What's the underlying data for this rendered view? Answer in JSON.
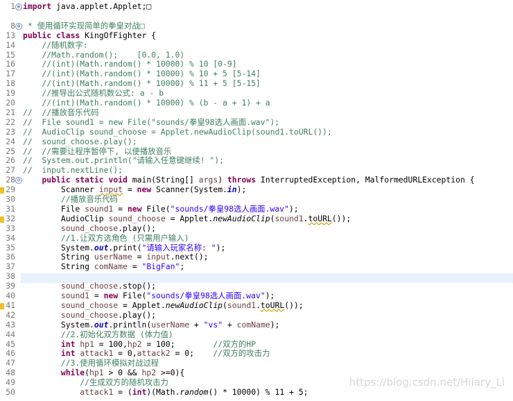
{
  "editor": {
    "language": "Java",
    "folded_line_markers": [
      "⊕",
      "⊕",
      "⊖"
    ],
    "lines": [
      {
        "n": "1",
        "segs": [
          {
            "c": "kw",
            "t": "import"
          },
          {
            "c": "",
            "t": " java.applet.Applet;□"
          }
        ]
      },
      {
        "n": "",
        "segs": []
      },
      {
        "n": "8",
        "segs": [
          {
            "c": "cm",
            "t": " * 使用循环实现简单的拳皇对战□"
          }
        ]
      },
      {
        "n": "13",
        "segs": [
          {
            "c": "kw",
            "t": "public class"
          },
          {
            "c": "",
            "t": " KingOfFighter {"
          }
        ]
      },
      {
        "n": "14",
        "segs": [
          {
            "c": "cm",
            "t": "    //随机数字:"
          }
        ]
      },
      {
        "n": "15",
        "segs": [
          {
            "c": "cm",
            "t": "    //Math.random();    [0.0, 1.0)"
          }
        ]
      },
      {
        "n": "16",
        "segs": [
          {
            "c": "cm",
            "t": "    //(int)(Math.random() * 10000) % 10 [0-9]"
          }
        ]
      },
      {
        "n": "17",
        "segs": [
          {
            "c": "cm",
            "t": "    //(int)(Math.random() * 10000) % 10 + 5 [5-14]"
          }
        ]
      },
      {
        "n": "18",
        "segs": [
          {
            "c": "cm",
            "t": "    //(int)(Math.random() * 10000) % 11 + 5 [5-15]"
          }
        ]
      },
      {
        "n": "19",
        "segs": [
          {
            "c": "cm",
            "t": "    //推导出公式随机数公式: a - b"
          }
        ]
      },
      {
        "n": "20",
        "segs": [
          {
            "c": "cm",
            "t": "    //(int)(Math.random() * 10000) % (b - a + 1) + a"
          }
        ]
      },
      {
        "n": "21",
        "segs": [
          {
            "c": "cm",
            "t": "//  //播放音乐代码"
          }
        ]
      },
      {
        "n": "22",
        "segs": [
          {
            "c": "cm",
            "t": "//  File sound1 = new File(\"sounds/拳皇98选人画面.wav\");"
          }
        ]
      },
      {
        "n": "23",
        "segs": [
          {
            "c": "cm",
            "t": "//  AudioClip sound_choose = Applet.newAudioClip(sound1.toURL());"
          }
        ]
      },
      {
        "n": "24",
        "segs": [
          {
            "c": "cm",
            "t": "//  sound_choose.play();"
          }
        ]
      },
      {
        "n": "25",
        "segs": [
          {
            "c": "cm",
            "t": "//  //需要让程序暂停下, 以便播放音乐"
          }
        ]
      },
      {
        "n": "26",
        "segs": [
          {
            "c": "cm",
            "t": "//  System.out.println(\"请输入任意键继续! \");"
          }
        ]
      },
      {
        "n": "27",
        "segs": [
          {
            "c": "cm",
            "t": "//  input.nextLine();"
          }
        ]
      },
      {
        "n": "28",
        "segs": [
          {
            "c": "",
            "t": "    "
          },
          {
            "c": "kw",
            "t": "public static void"
          },
          {
            "c": "",
            "t": " main(String[] "
          },
          {
            "c": "lv",
            "t": "args"
          },
          {
            "c": "",
            "t": ") "
          },
          {
            "c": "kw",
            "t": "throws"
          },
          {
            "c": "",
            "t": " InterruptedException, MalformedURLException {"
          }
        ]
      },
      {
        "n": "29",
        "segs": [
          {
            "c": "",
            "t": "        Scanner "
          },
          {
            "c": "lv warn",
            "t": "input"
          },
          {
            "c": "",
            "t": " = "
          },
          {
            "c": "kw",
            "t": "new"
          },
          {
            "c": "",
            "t": " Scanner(System."
          },
          {
            "c": "fld",
            "t": "in"
          },
          {
            "c": "",
            "t": ");"
          }
        ]
      },
      {
        "n": "30",
        "segs": [
          {
            "c": "cm",
            "t": "        //播放音乐代码"
          }
        ]
      },
      {
        "n": "31",
        "segs": [
          {
            "c": "",
            "t": "        File "
          },
          {
            "c": "lv",
            "t": "sound1"
          },
          {
            "c": "",
            "t": " = "
          },
          {
            "c": "kw",
            "t": "new"
          },
          {
            "c": "",
            "t": " File("
          },
          {
            "c": "st",
            "t": "\"sounds/拳皇98选人画面.wav\""
          },
          {
            "c": "",
            "t": ");"
          }
        ]
      },
      {
        "n": "32",
        "segs": [
          {
            "c": "",
            "t": "        AudioClip "
          },
          {
            "c": "lv",
            "t": "sound_choose"
          },
          {
            "c": "",
            "t": " = Applet."
          },
          {
            "c": "it",
            "t": "newAudioClip"
          },
          {
            "c": "",
            "t": "("
          },
          {
            "c": "lv",
            "t": "sound1"
          },
          {
            "c": "",
            "t": "."
          },
          {
            "c": "strike warn",
            "t": "toURL"
          },
          {
            "c": "",
            "t": "());"
          }
        ]
      },
      {
        "n": "33",
        "segs": [
          {
            "c": "",
            "t": "        "
          },
          {
            "c": "lv",
            "t": "sound_choose"
          },
          {
            "c": "",
            "t": ".play();"
          }
        ]
      },
      {
        "n": "34",
        "segs": [
          {
            "c": "cm",
            "t": "        //1.让双方选角色 (只需用户输入)"
          }
        ]
      },
      {
        "n": "35",
        "segs": [
          {
            "c": "",
            "t": "        System."
          },
          {
            "c": "fld",
            "t": "out"
          },
          {
            "c": "",
            "t": ".print("
          },
          {
            "c": "st",
            "t": "\"请输入玩家名称: \""
          },
          {
            "c": "",
            "t": ");"
          }
        ]
      },
      {
        "n": "36",
        "segs": [
          {
            "c": "",
            "t": "        String "
          },
          {
            "c": "lv",
            "t": "userName"
          },
          {
            "c": "",
            "t": " = "
          },
          {
            "c": "lv",
            "t": "input"
          },
          {
            "c": "",
            "t": ".next();"
          }
        ]
      },
      {
        "n": "37",
        "segs": [
          {
            "c": "",
            "t": "        String "
          },
          {
            "c": "lv",
            "t": "comName"
          },
          {
            "c": "",
            "t": " = "
          },
          {
            "c": "st",
            "t": "\"BigFan\""
          },
          {
            "c": "",
            "t": ";"
          }
        ]
      },
      {
        "n": "38",
        "segs": []
      },
      {
        "n": "39",
        "segs": [
          {
            "c": "",
            "t": "        "
          },
          {
            "c": "lv",
            "t": "sound_choose"
          },
          {
            "c": "",
            "t": ".stop();"
          }
        ]
      },
      {
        "n": "40",
        "segs": [
          {
            "c": "",
            "t": "        "
          },
          {
            "c": "lv",
            "t": "sound1"
          },
          {
            "c": "",
            "t": " = "
          },
          {
            "c": "kw",
            "t": "new"
          },
          {
            "c": "",
            "t": " File("
          },
          {
            "c": "st",
            "t": "\"sounds/拳皇98选人画面.wav\""
          },
          {
            "c": "",
            "t": ");"
          }
        ]
      },
      {
        "n": "41",
        "segs": [
          {
            "c": "",
            "t": "        "
          },
          {
            "c": "lv",
            "t": "sound_choose"
          },
          {
            "c": "",
            "t": " = Applet."
          },
          {
            "c": "it",
            "t": "newAudioClip"
          },
          {
            "c": "",
            "t": "("
          },
          {
            "c": "lv",
            "t": "sound1"
          },
          {
            "c": "",
            "t": "."
          },
          {
            "c": "strike warn",
            "t": "toURL"
          },
          {
            "c": "",
            "t": "());"
          }
        ]
      },
      {
        "n": "42",
        "segs": [
          {
            "c": "",
            "t": "        "
          },
          {
            "c": "lv",
            "t": "sound_choose"
          },
          {
            "c": "",
            "t": ".play();"
          }
        ]
      },
      {
        "n": "43",
        "segs": [
          {
            "c": "",
            "t": "        System."
          },
          {
            "c": "fld",
            "t": "out"
          },
          {
            "c": "",
            "t": ".println("
          },
          {
            "c": "lv",
            "t": "userName"
          },
          {
            "c": "",
            "t": " + "
          },
          {
            "c": "st",
            "t": "\"vs\""
          },
          {
            "c": "",
            "t": " + "
          },
          {
            "c": "lv",
            "t": "comName"
          },
          {
            "c": "",
            "t": ");"
          }
        ]
      },
      {
        "n": "44",
        "segs": [
          {
            "c": "cm",
            "t": "        //2.初始化双方数据 (体力值)"
          }
        ]
      },
      {
        "n": "45",
        "segs": [
          {
            "c": "",
            "t": "        "
          },
          {
            "c": "kw",
            "t": "int"
          },
          {
            "c": "",
            "t": " "
          },
          {
            "c": "lv",
            "t": "hp1"
          },
          {
            "c": "",
            "t": " = 100,"
          },
          {
            "c": "lv",
            "t": "hp2"
          },
          {
            "c": "",
            "t": " = 100;        "
          },
          {
            "c": "cm",
            "t": "//双方的HP"
          }
        ]
      },
      {
        "n": "46",
        "segs": [
          {
            "c": "",
            "t": "        "
          },
          {
            "c": "kw",
            "t": "int"
          },
          {
            "c": "",
            "t": " "
          },
          {
            "c": "lv",
            "t": "attack1"
          },
          {
            "c": "",
            "t": " = 0,"
          },
          {
            "c": "lv",
            "t": "attack2"
          },
          {
            "c": "",
            "t": " = 0;    "
          },
          {
            "c": "cm",
            "t": "//双方的攻击力"
          }
        ]
      },
      {
        "n": "47",
        "segs": [
          {
            "c": "cm",
            "t": "        //3.使用循环模拟对战过程"
          }
        ]
      },
      {
        "n": "48",
        "segs": [
          {
            "c": "",
            "t": "        "
          },
          {
            "c": "kw",
            "t": "while"
          },
          {
            "c": "",
            "t": "("
          },
          {
            "c": "lv",
            "t": "hp1"
          },
          {
            "c": "",
            "t": " > 0 && "
          },
          {
            "c": "lv",
            "t": "hp2"
          },
          {
            "c": "",
            "t": " >=0){"
          }
        ]
      },
      {
        "n": "49",
        "segs": [
          {
            "c": "cm",
            "t": "            //生成双方的随机攻击力"
          }
        ]
      },
      {
        "n": "50",
        "segs": [
          {
            "c": "",
            "t": "            "
          },
          {
            "c": "lv",
            "t": "attack1"
          },
          {
            "c": "",
            "t": " = ("
          },
          {
            "c": "kw",
            "t": "int"
          },
          {
            "c": "",
            "t": ")(Math."
          },
          {
            "c": "it",
            "t": "random"
          },
          {
            "c": "",
            "t": "() * 10000) % 11 + 5;"
          }
        ]
      }
    ],
    "current_line": "38",
    "watermark": "https://blog.csdn.net/Hilary_Li"
  }
}
